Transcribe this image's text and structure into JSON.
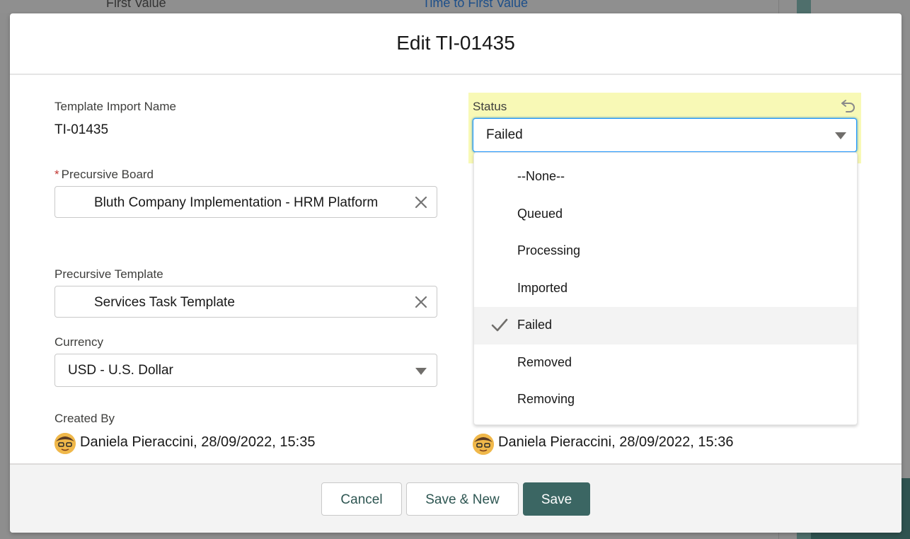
{
  "background": {
    "left_text": "First Value",
    "link_text": "Time to First Value"
  },
  "modal": {
    "title": "Edit TI-01435"
  },
  "fields": {
    "template_import_name": {
      "label": "Template Import Name",
      "value": "TI-01435"
    },
    "precursive_board": {
      "label": "Precursive Board",
      "required_mark": "*",
      "value": "Bluth Company Implementation - HRM Platform"
    },
    "precursive_template": {
      "label": "Precursive Template",
      "value": "Services Task Template"
    },
    "currency": {
      "label": "Currency",
      "value": "USD - U.S. Dollar"
    },
    "created_by": {
      "label": "Created By",
      "value": "Daniela Pieraccini, 28/09/2022, 15:35"
    },
    "last_modified_by": {
      "value": "Daniela Pieraccini, 28/09/2022, 15:36"
    },
    "status": {
      "label": "Status",
      "value": "Failed",
      "options": [
        "--None--",
        "Queued",
        "Processing",
        "Imported",
        "Failed",
        "Removed",
        "Removing"
      ],
      "selected_index": 4
    }
  },
  "footer": {
    "cancel_label": "Cancel",
    "save_new_label": "Save & New",
    "save_label": "Save"
  },
  "colors": {
    "brand": "#3b6663",
    "highlight": "#f8f9b6",
    "required": "#c23934"
  }
}
